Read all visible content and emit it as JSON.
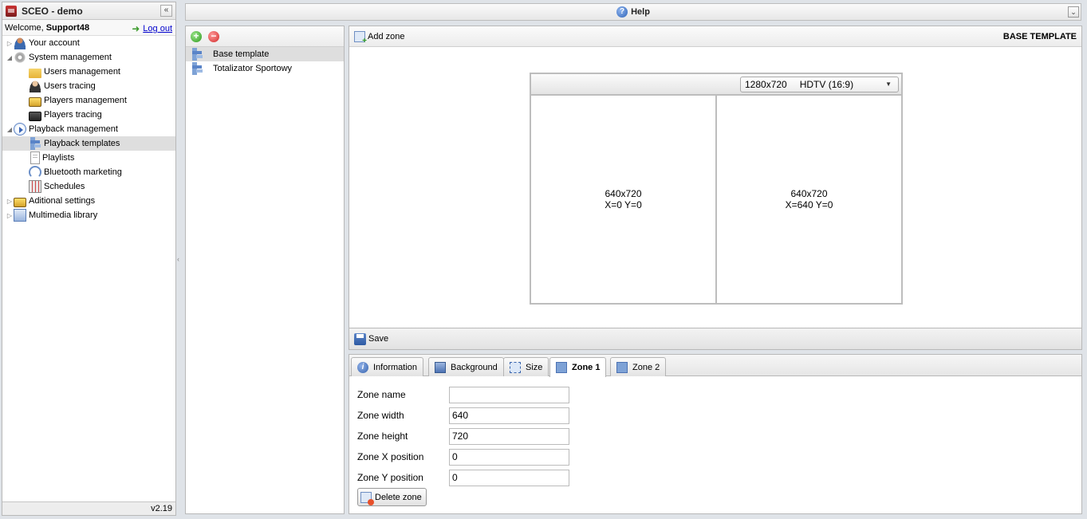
{
  "app": {
    "title": "SCEO - demo"
  },
  "user": {
    "welcome": "Welcome,",
    "name": "Support48",
    "logout": "Log out"
  },
  "nav": {
    "your_account": "Your account",
    "system_management": "System management",
    "users_management": "Users management",
    "users_tracing": "Users tracing",
    "players_management": "Players management",
    "players_tracing": "Players tracing",
    "playback_management": "Playback management",
    "playback_templates": "Playback templates",
    "playlists": "Playlists",
    "bluetooth_marketing": "Bluetooth marketing",
    "schedules": "Schedules",
    "aditional_settings": "Aditional settings",
    "multimedia_library": "Multimedia library",
    "selected": "Playback templates"
  },
  "version": "v2.19",
  "help": {
    "label": "Help"
  },
  "templates": {
    "items": [
      {
        "label": "Base template",
        "selected": true
      },
      {
        "label": "Totalizator Sportowy",
        "selected": false
      }
    ]
  },
  "editor": {
    "add_zone": "Add zone",
    "title": "BASE TEMPLATE",
    "resolution": "1280x720",
    "format": "HDTV (16:9)",
    "zones": [
      {
        "size": "640x720",
        "pos": "X=0 Y=0"
      },
      {
        "size": "640x720",
        "pos": "X=640 Y=0"
      }
    ],
    "save": "Save"
  },
  "tabs": {
    "information": "Information",
    "background": "Background",
    "size": "Size",
    "zone1": "Zone 1",
    "zone2": "Zone 2",
    "active": "Zone 1"
  },
  "zone_form": {
    "name_label": "Zone name",
    "name_value": "",
    "width_label": "Zone width",
    "width_value": "640",
    "height_label": "Zone height",
    "height_value": "720",
    "x_label": "Zone X position",
    "x_value": "0",
    "y_label": "Zone Y position",
    "y_value": "0",
    "delete": "Delete zone"
  }
}
